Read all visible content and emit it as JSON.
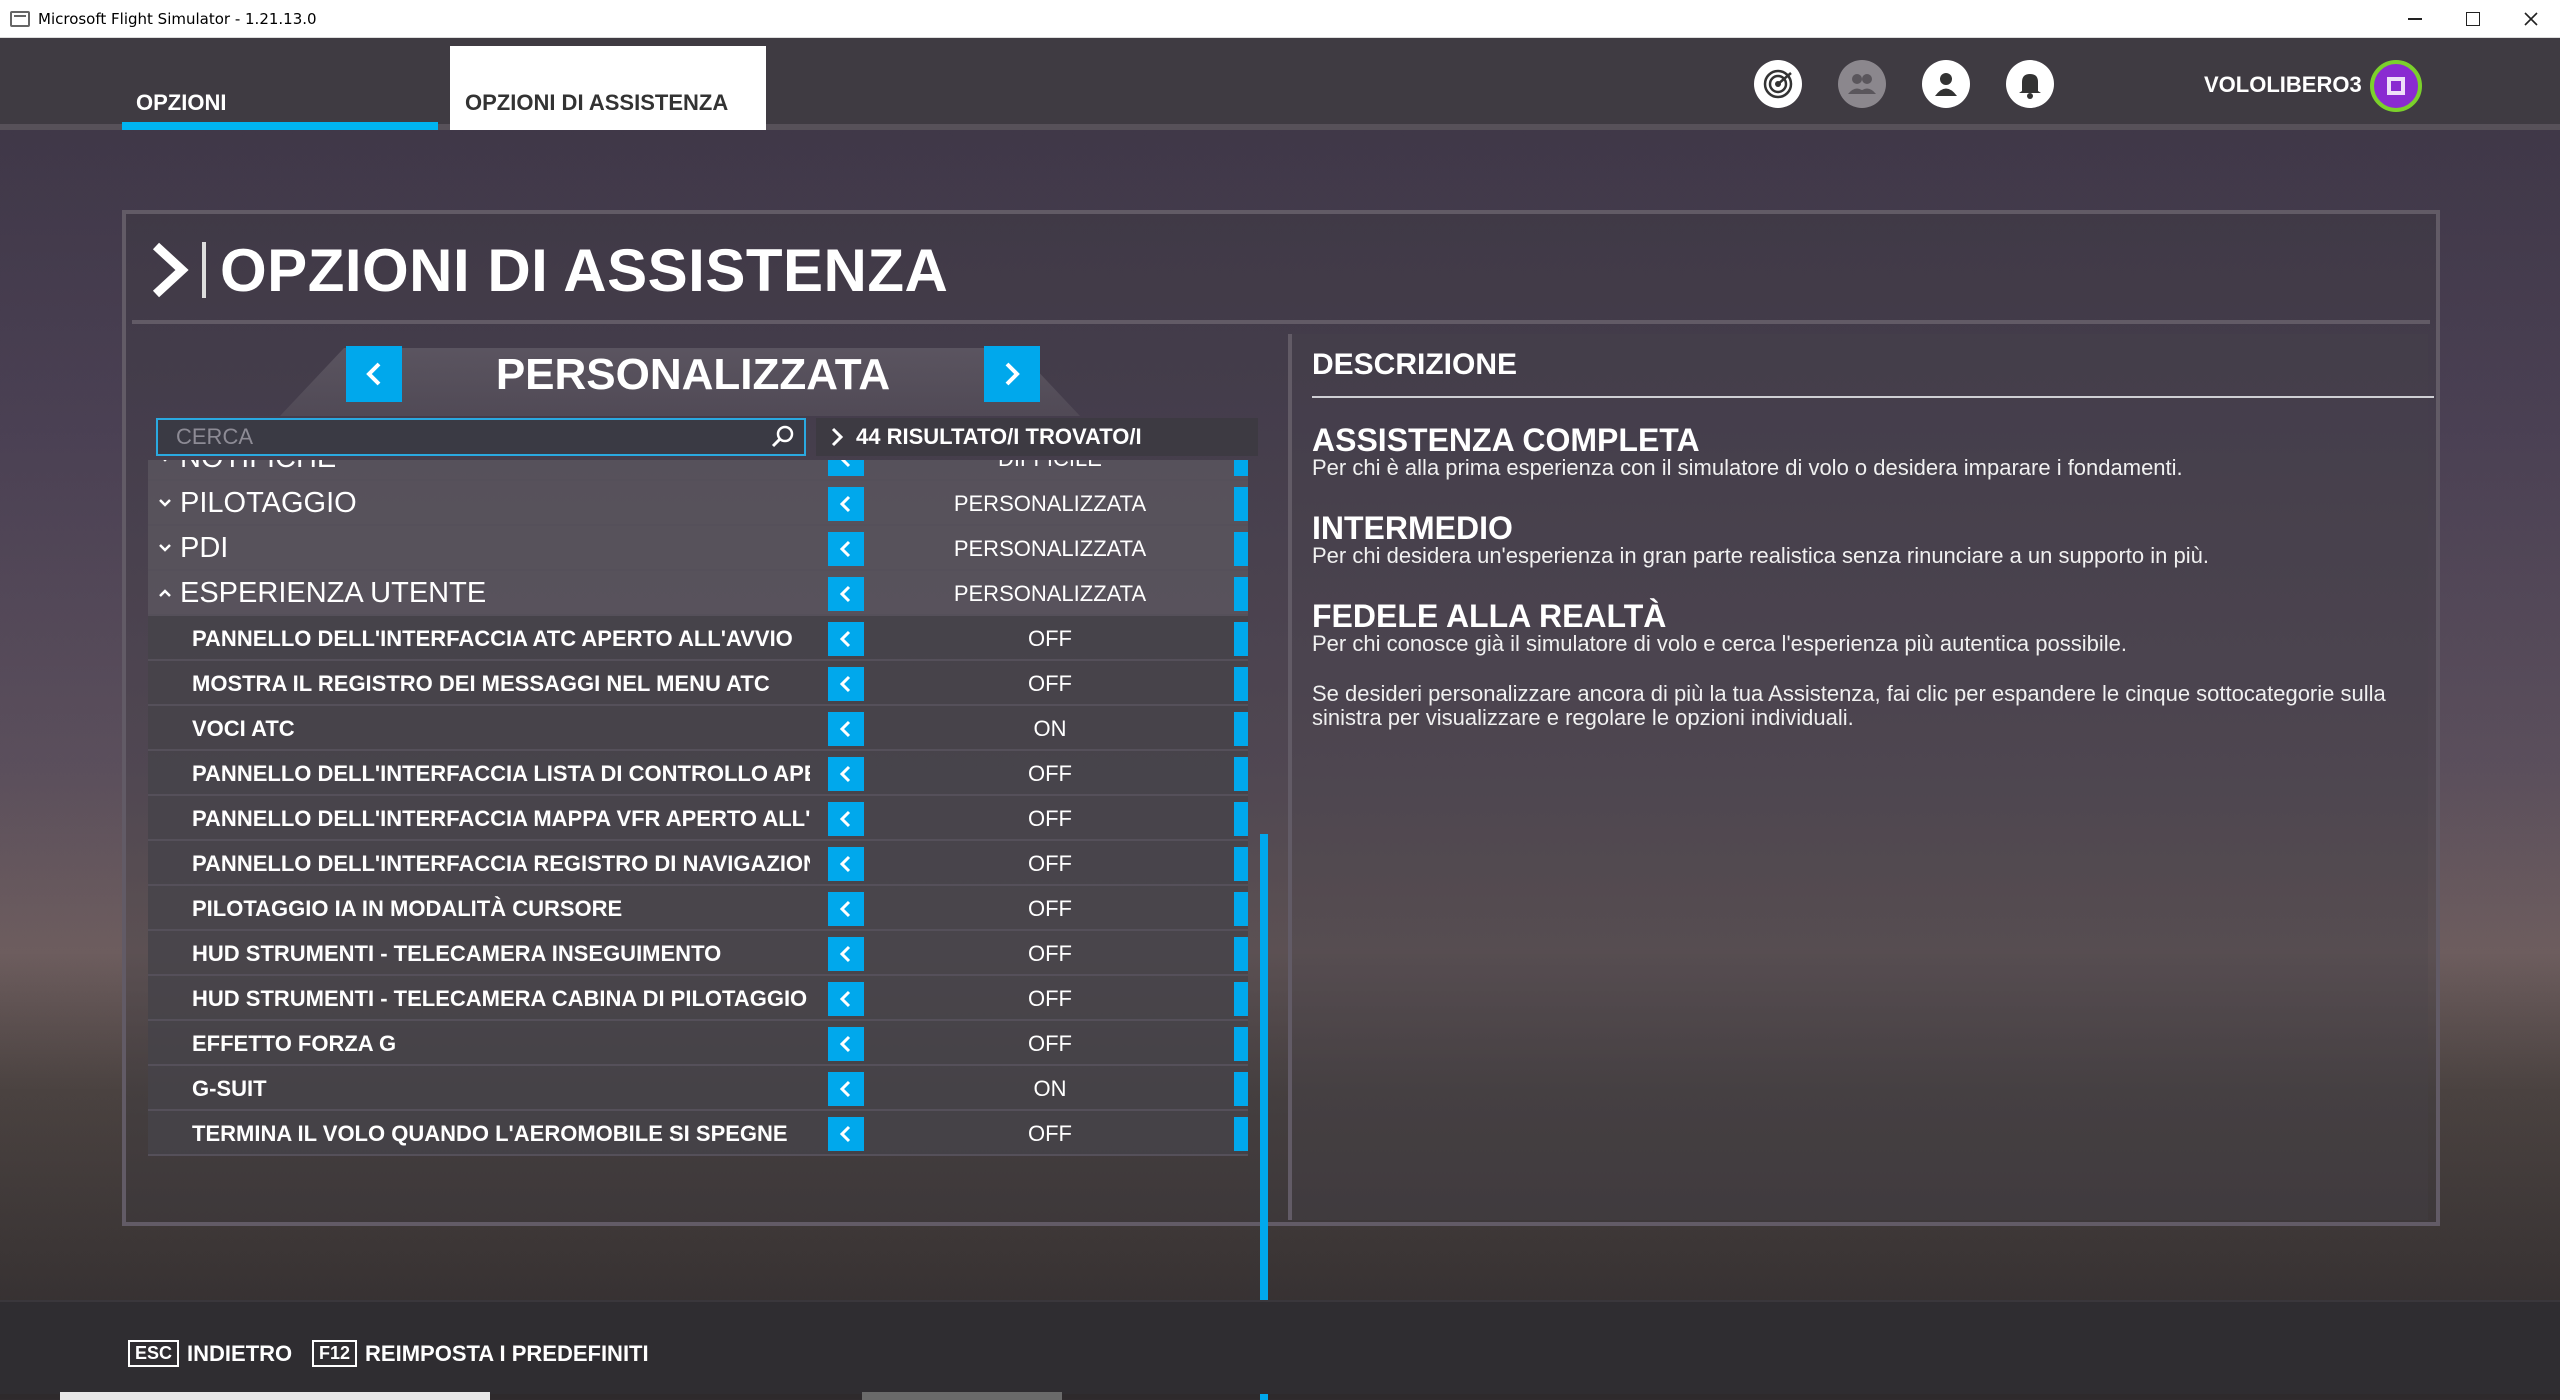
{
  "window": {
    "title": "Microsoft Flight Simulator - 1.21.13.0"
  },
  "nav": {
    "tabs": [
      {
        "label": "OPZIONI"
      },
      {
        "label": "OPZIONI DI ASSISTENZA"
      }
    ],
    "username": "VOLOLIBERO3",
    "accent": "#00b4f0"
  },
  "panel": {
    "title": "OPZIONI DI ASSISTENZA"
  },
  "preset": {
    "label": "PERSONALIZZATA"
  },
  "search": {
    "placeholder": "CERCA",
    "value": ""
  },
  "results": {
    "label": "44 RISULTATO/I TROVATO/I"
  },
  "list": {
    "rows": [
      {
        "type": "category",
        "label": "NOTIFICHE",
        "value": "DIFFICILE",
        "expanded": false
      },
      {
        "type": "category",
        "label": "PILOTAGGIO",
        "value": "PERSONALIZZATA",
        "expanded": false
      },
      {
        "type": "category",
        "label": "PDI",
        "value": "PERSONALIZZATA",
        "expanded": false
      },
      {
        "type": "category",
        "label": "ESPERIENZA UTENTE",
        "value": "PERSONALIZZATA",
        "expanded": true
      },
      {
        "type": "item",
        "label": "PANNELLO DELL'INTERFACCIA ATC APERTO ALL'AVVIO",
        "value": "OFF"
      },
      {
        "type": "item",
        "label": "MOSTRA IL REGISTRO DEI MESSAGGI NEL MENU ATC",
        "value": "OFF"
      },
      {
        "type": "item",
        "label": "VOCI ATC",
        "value": "ON"
      },
      {
        "type": "item",
        "label": "PANNELLO DELL'INTERFACCIA LISTA DI CONTROLLO APERTO ALL'AVVIO",
        "value": "OFF"
      },
      {
        "type": "item",
        "label": "PANNELLO DELL'INTERFACCIA MAPPA VFR APERTO ALL'AVVIO",
        "value": "OFF"
      },
      {
        "type": "item",
        "label": "PANNELLO DELL'INTERFACCIA REGISTRO DI NAVIGAZIONE APERTO ALL'AVVIO",
        "value": "OFF"
      },
      {
        "type": "item",
        "label": "PILOTAGGIO IA IN MODALITÀ CURSORE",
        "value": "OFF"
      },
      {
        "type": "item",
        "label": "HUD STRUMENTI - TELECAMERA INSEGUIMENTO",
        "value": "OFF"
      },
      {
        "type": "item",
        "label": "HUD STRUMENTI - TELECAMERA CABINA DI PILOTAGGIO",
        "value": "OFF"
      },
      {
        "type": "item",
        "label": "EFFETTO FORZA G",
        "value": "OFF"
      },
      {
        "type": "item",
        "label": "G-SUIT",
        "value": "ON"
      },
      {
        "type": "item",
        "label": "TERMINA IL VOLO QUANDO L'AEROMOBILE SI SPEGNE",
        "value": "OFF"
      }
    ]
  },
  "description": {
    "heading": "DESCRIZIONE",
    "sections": [
      {
        "title": "ASSISTENZA COMPLETA",
        "text": "Per chi è alla prima esperienza con il simulatore di volo o desidera imparare i fondamenti."
      },
      {
        "title": "INTERMEDIO",
        "text": "Per chi desidera un'esperienza in gran parte realistica senza rinunciare a un supporto in più."
      },
      {
        "title": "FEDELE ALLA REALTÀ",
        "text": "Per chi conosce già il simulatore di volo e cerca l'esperienza più autentica possibile."
      }
    ],
    "note": "Se desideri personalizzare ancora di più la tua Assistenza, fai clic per espandere le cinque sottocategorie sulla sinistra per visualizzare e regolare le opzioni individuali."
  },
  "footer": {
    "esc_key": "ESC",
    "esc_label": "INDIETRO",
    "f12_key": "F12",
    "f12_label": "REIMPOSTA I PREDEFINITI"
  }
}
